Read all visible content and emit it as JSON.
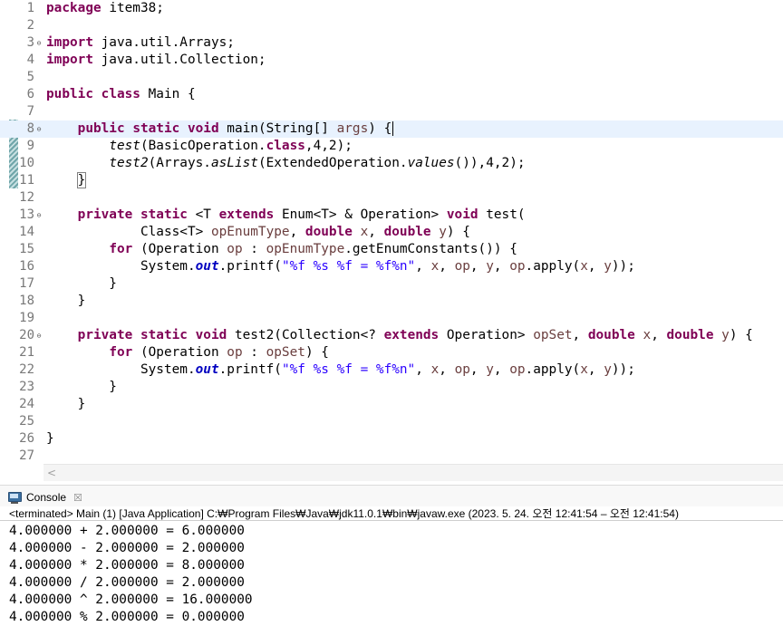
{
  "editor": {
    "lines": [
      {
        "n": "1",
        "fold": "",
        "tokens": [
          {
            "t": "kw",
            "v": "package"
          },
          {
            "t": "",
            "v": " item38;"
          }
        ]
      },
      {
        "n": "2",
        "fold": "",
        "tokens": []
      },
      {
        "n": "3",
        "fold": "⊖",
        "tokens": [
          {
            "t": "kw",
            "v": "import"
          },
          {
            "t": "",
            "v": " java.util.Arrays;"
          }
        ]
      },
      {
        "n": "4",
        "fold": "",
        "tokens": [
          {
            "t": "kw",
            "v": "import"
          },
          {
            "t": "",
            "v": " java.util.Collection;"
          }
        ]
      },
      {
        "n": "5",
        "fold": "",
        "tokens": []
      },
      {
        "n": "6",
        "fold": "",
        "tokens": [
          {
            "t": "kw",
            "v": "public"
          },
          {
            "t": "",
            "v": " "
          },
          {
            "t": "kw",
            "v": "class"
          },
          {
            "t": "",
            "v": " Main {"
          }
        ]
      },
      {
        "n": "7",
        "fold": "",
        "tokens": []
      },
      {
        "n": "8",
        "fold": "⊖",
        "current": true,
        "tokens": [
          {
            "t": "",
            "v": "    "
          },
          {
            "t": "kw",
            "v": "public"
          },
          {
            "t": "",
            "v": " "
          },
          {
            "t": "kw",
            "v": "static"
          },
          {
            "t": "",
            "v": " "
          },
          {
            "t": "kw",
            "v": "void"
          },
          {
            "t": "",
            "v": " main(String[] "
          },
          {
            "t": "var",
            "v": "args"
          },
          {
            "t": "",
            "v": ") {"
          },
          {
            "t": "caret",
            "v": ""
          }
        ]
      },
      {
        "n": "9",
        "fold": "",
        "tokens": [
          {
            "t": "",
            "v": "        "
          },
          {
            "t": "sm",
            "v": "test"
          },
          {
            "t": "",
            "v": "(BasicOperation."
          },
          {
            "t": "kw",
            "v": "class"
          },
          {
            "t": "",
            "v": ",4,2);"
          }
        ]
      },
      {
        "n": "10",
        "fold": "",
        "tokens": [
          {
            "t": "",
            "v": "        "
          },
          {
            "t": "sm",
            "v": "test2"
          },
          {
            "t": "",
            "v": "(Arrays."
          },
          {
            "t": "sm",
            "v": "asList"
          },
          {
            "t": "",
            "v": "(ExtendedOperation."
          },
          {
            "t": "sm",
            "v": "values"
          },
          {
            "t": "",
            "v": "()),4,2);"
          }
        ]
      },
      {
        "n": "11",
        "fold": "",
        "tokens": [
          {
            "t": "",
            "v": "    "
          },
          {
            "t": "bracket",
            "v": "}"
          }
        ]
      },
      {
        "n": "12",
        "fold": "",
        "tokens": []
      },
      {
        "n": "13",
        "fold": "⊖",
        "tokens": [
          {
            "t": "",
            "v": "    "
          },
          {
            "t": "kw",
            "v": "private"
          },
          {
            "t": "",
            "v": " "
          },
          {
            "t": "kw",
            "v": "static"
          },
          {
            "t": "",
            "v": " <T "
          },
          {
            "t": "kw",
            "v": "extends"
          },
          {
            "t": "",
            "v": " Enum<T> & Operation> "
          },
          {
            "t": "kw",
            "v": "void"
          },
          {
            "t": "",
            "v": " test("
          }
        ]
      },
      {
        "n": "14",
        "fold": "",
        "tokens": [
          {
            "t": "",
            "v": "            Class<T> "
          },
          {
            "t": "var",
            "v": "opEnumType"
          },
          {
            "t": "",
            "v": ", "
          },
          {
            "t": "kw",
            "v": "double"
          },
          {
            "t": "",
            "v": " "
          },
          {
            "t": "var",
            "v": "x"
          },
          {
            "t": "",
            "v": ", "
          },
          {
            "t": "kw",
            "v": "double"
          },
          {
            "t": "",
            "v": " "
          },
          {
            "t": "var",
            "v": "y"
          },
          {
            "t": "",
            "v": ") {"
          }
        ]
      },
      {
        "n": "15",
        "fold": "",
        "tokens": [
          {
            "t": "",
            "v": "        "
          },
          {
            "t": "kw",
            "v": "for"
          },
          {
            "t": "",
            "v": " (Operation "
          },
          {
            "t": "var",
            "v": "op"
          },
          {
            "t": "",
            "v": " : "
          },
          {
            "t": "var",
            "v": "opEnumType"
          },
          {
            "t": "",
            "v": ".getEnumConstants()) {"
          }
        ]
      },
      {
        "n": "16",
        "fold": "",
        "tokens": [
          {
            "t": "",
            "v": "            System."
          },
          {
            "t": "fld",
            "v": "out"
          },
          {
            "t": "",
            "v": ".printf("
          },
          {
            "t": "str",
            "v": "\"%f %s %f = %f%n\""
          },
          {
            "t": "",
            "v": ", "
          },
          {
            "t": "var",
            "v": "x"
          },
          {
            "t": "",
            "v": ", "
          },
          {
            "t": "var",
            "v": "op"
          },
          {
            "t": "",
            "v": ", "
          },
          {
            "t": "var",
            "v": "y"
          },
          {
            "t": "",
            "v": ", "
          },
          {
            "t": "var",
            "v": "op"
          },
          {
            "t": "",
            "v": ".apply("
          },
          {
            "t": "var",
            "v": "x"
          },
          {
            "t": "",
            "v": ", "
          },
          {
            "t": "var",
            "v": "y"
          },
          {
            "t": "",
            "v": "));"
          }
        ]
      },
      {
        "n": "17",
        "fold": "",
        "tokens": [
          {
            "t": "",
            "v": "        }"
          }
        ]
      },
      {
        "n": "18",
        "fold": "",
        "tokens": [
          {
            "t": "",
            "v": "    }"
          }
        ]
      },
      {
        "n": "19",
        "fold": "",
        "tokens": []
      },
      {
        "n": "20",
        "fold": "⊖",
        "tokens": [
          {
            "t": "",
            "v": "    "
          },
          {
            "t": "kw",
            "v": "private"
          },
          {
            "t": "",
            "v": " "
          },
          {
            "t": "kw",
            "v": "static"
          },
          {
            "t": "",
            "v": " "
          },
          {
            "t": "kw",
            "v": "void"
          },
          {
            "t": "",
            "v": " test2(Collection<? "
          },
          {
            "t": "kw",
            "v": "extends"
          },
          {
            "t": "",
            "v": " Operation> "
          },
          {
            "t": "var",
            "v": "opSet"
          },
          {
            "t": "",
            "v": ", "
          },
          {
            "t": "kw",
            "v": "double"
          },
          {
            "t": "",
            "v": " "
          },
          {
            "t": "var",
            "v": "x"
          },
          {
            "t": "",
            "v": ", "
          },
          {
            "t": "kw",
            "v": "double"
          },
          {
            "t": "",
            "v": " "
          },
          {
            "t": "var",
            "v": "y"
          },
          {
            "t": "",
            "v": ") {"
          }
        ]
      },
      {
        "n": "21",
        "fold": "",
        "tokens": [
          {
            "t": "",
            "v": "        "
          },
          {
            "t": "kw",
            "v": "for"
          },
          {
            "t": "",
            "v": " (Operation "
          },
          {
            "t": "var",
            "v": "op"
          },
          {
            "t": "",
            "v": " : "
          },
          {
            "t": "var",
            "v": "opSet"
          },
          {
            "t": "",
            "v": ") {"
          }
        ]
      },
      {
        "n": "22",
        "fold": "",
        "tokens": [
          {
            "t": "",
            "v": "            System."
          },
          {
            "t": "fld",
            "v": "out"
          },
          {
            "t": "",
            "v": ".printf("
          },
          {
            "t": "str",
            "v": "\"%f %s %f = %f%n\""
          },
          {
            "t": "",
            "v": ", "
          },
          {
            "t": "var",
            "v": "x"
          },
          {
            "t": "",
            "v": ", "
          },
          {
            "t": "var",
            "v": "op"
          },
          {
            "t": "",
            "v": ", "
          },
          {
            "t": "var",
            "v": "y"
          },
          {
            "t": "",
            "v": ", "
          },
          {
            "t": "var",
            "v": "op"
          },
          {
            "t": "",
            "v": ".apply("
          },
          {
            "t": "var",
            "v": "x"
          },
          {
            "t": "",
            "v": ", "
          },
          {
            "t": "var",
            "v": "y"
          },
          {
            "t": "",
            "v": "));"
          }
        ]
      },
      {
        "n": "23",
        "fold": "",
        "tokens": [
          {
            "t": "",
            "v": "        }"
          }
        ]
      },
      {
        "n": "24",
        "fold": "",
        "tokens": [
          {
            "t": "",
            "v": "    }"
          }
        ]
      },
      {
        "n": "25",
        "fold": "",
        "tokens": []
      },
      {
        "n": "26",
        "fold": "",
        "tokens": [
          {
            "t": "",
            "v": "}"
          }
        ]
      },
      {
        "n": "27",
        "fold": "",
        "tokens": []
      }
    ],
    "scroll_left_icon": "chevron-left-icon",
    "colors": {
      "keyword": "#7f0055",
      "string": "#2a00ff",
      "field": "#0000c0",
      "variable": "#6a3e3e",
      "current_line": "#e8f2fe"
    }
  },
  "console": {
    "tab_label": "Console",
    "tab_close": "☒",
    "tab_icon": "console-icon",
    "status": "<terminated> Main (1) [Java Application] C:₩Program Files₩Java₩jdk11.0.1₩bin₩javaw.exe  (2023. 5. 24. 오전 12:41:54 – 오전 12:41:54)",
    "output": [
      "4.000000 + 2.000000 = 6.000000",
      "4.000000 - 2.000000 = 2.000000",
      "4.000000 * 2.000000 = 8.000000",
      "4.000000 / 2.000000 = 2.000000",
      "4.000000 ^ 2.000000 = 16.000000",
      "4.000000 % 2.000000 = 0.000000"
    ]
  }
}
